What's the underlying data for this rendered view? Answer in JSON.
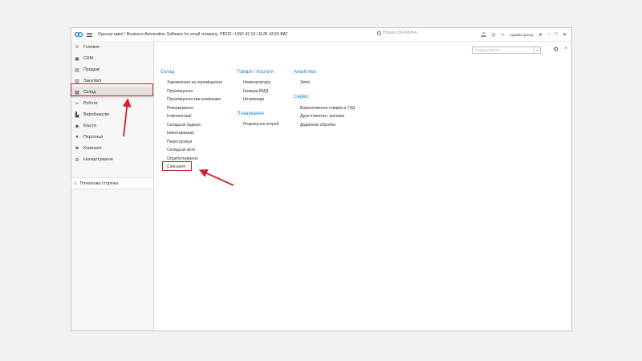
{
  "window": {
    "title": "Одеські вміні / Business Automation Software for small company, PROF / USD 42,16 / EUR 43,50 ВАГ",
    "top_search_placeholder": "Пошук Ctrl+Shift+F",
    "user": "Адміністратор"
  },
  "sidebar": {
    "items": [
      {
        "label": "Головне",
        "icon": "menu-lines-icon"
      },
      {
        "label": "CRM",
        "icon": "crm-icon"
      },
      {
        "label": "Продажі",
        "icon": "sales-icon"
      },
      {
        "label": "Закупівлі",
        "icon": "purchases-icon"
      },
      {
        "label": "Склад",
        "icon": "warehouse-grid-icon"
      },
      {
        "label": "Роботи",
        "icon": "tools-icon"
      },
      {
        "label": "Виробництво",
        "icon": "production-icon"
      },
      {
        "label": "Кошти",
        "icon": "money-icon"
      },
      {
        "label": "Персонал",
        "icon": "person-icon"
      },
      {
        "label": "Компанія",
        "icon": "flag-icon"
      },
      {
        "label": "Налаштування",
        "icon": "gear-icon"
      }
    ],
    "home": "Початкова сторінка"
  },
  "main": {
    "search_placeholder": "Пошук (Ctrl+F)",
    "sections": {
      "sklad": {
        "title": "Склад",
        "links": [
          "Замовлення на переміщення",
          "Переміщення",
          "Переміщення між комірками",
          "Резервування",
          "Комплектації",
          "Складські ордери",
          "Інвентаризації",
          "Пересортиця",
          "Складські акти",
          "Оприбуткування",
          "Списання"
        ]
      },
      "tovary": {
        "title": "Товари і послуги",
        "links": [
          "Номенклатура",
          "Номера ВМД",
          "Штрихкоди"
        ]
      },
      "planuvannia": {
        "title": "Планування",
        "links": [
          "Розрахунок потреб"
        ]
      },
      "analityka": {
        "title": "Аналітика",
        "links": [
          "Звіти"
        ]
      },
      "servis": {
        "title": "Сервіс",
        "links": [
          "Вивантаження товарів в ТЗД",
          "Друк етикеток і цінників",
          "Додаткові обробки"
        ]
      }
    }
  },
  "colors": {
    "accent": "#1e88c9",
    "highlight": "#d1202a"
  }
}
